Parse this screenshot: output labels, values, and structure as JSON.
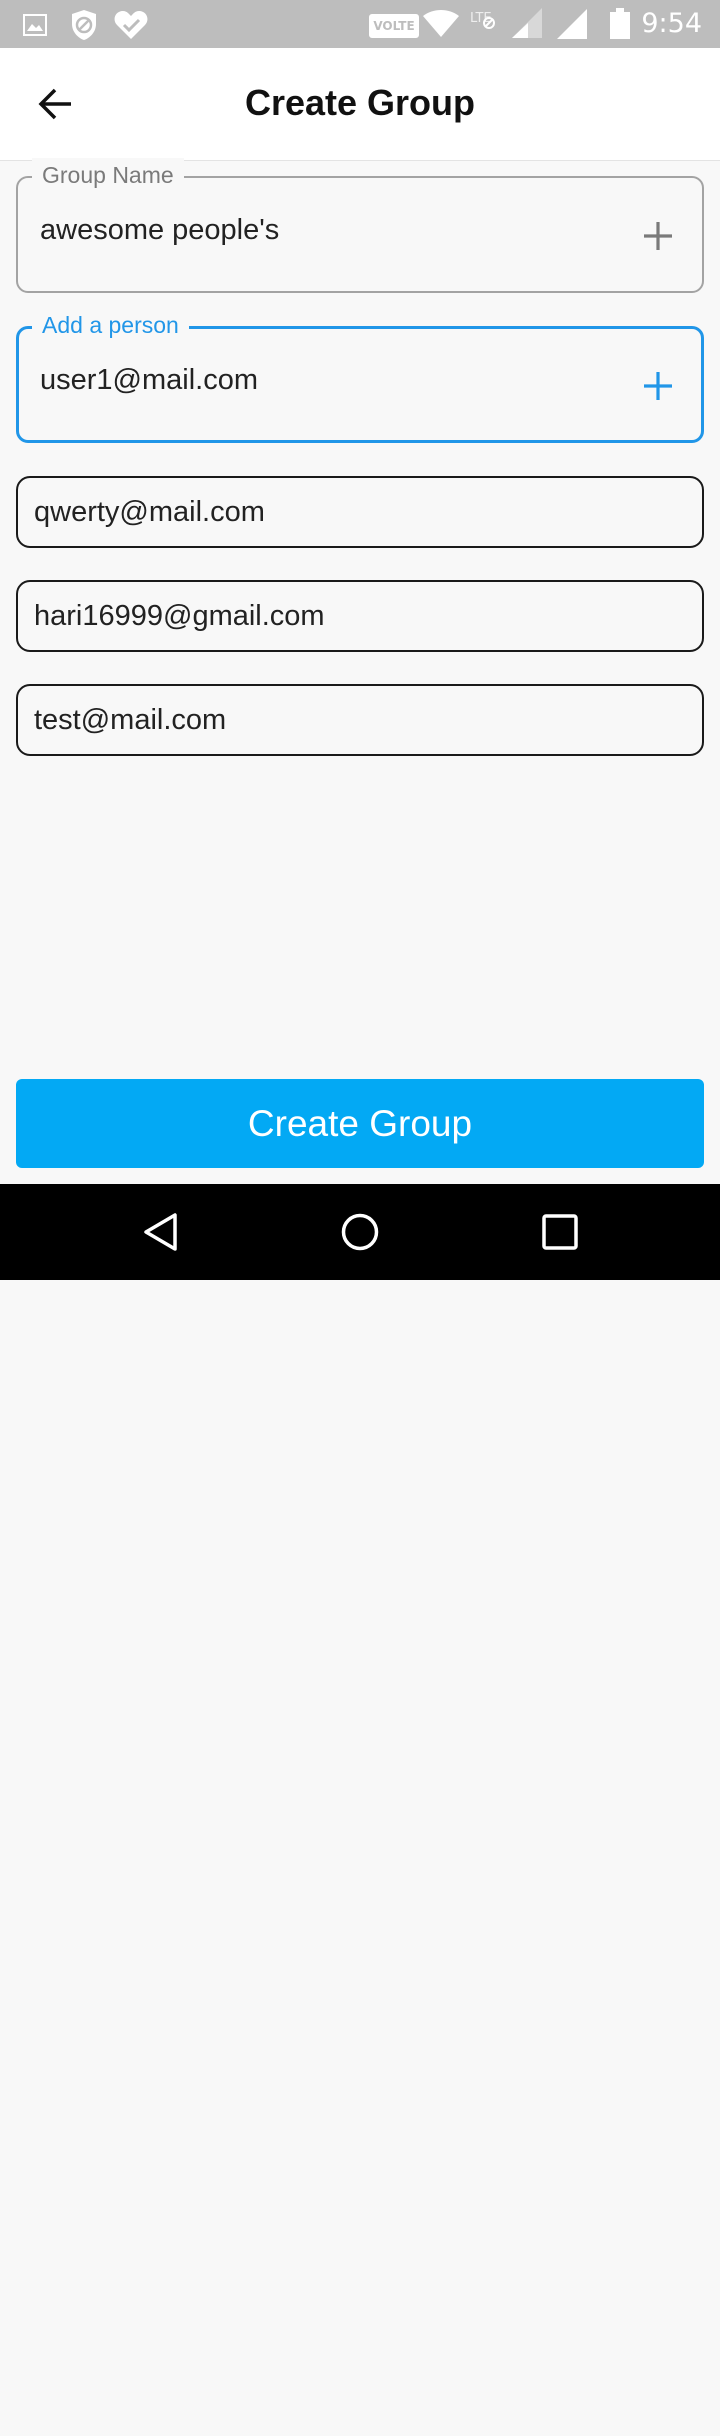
{
  "status_bar": {
    "time": "9:54",
    "volte": "VOLTE",
    "icons": [
      "image-icon",
      "shield-blocked-icon",
      "heart-check-icon",
      "wifi-icon",
      "lte-signal-icon",
      "signal-icon",
      "battery-icon"
    ]
  },
  "app_bar": {
    "title": "Create Group",
    "back_icon": "arrow-left-icon"
  },
  "group_name_field": {
    "label": "Group Name",
    "value": "awesome people's",
    "add_icon": "plus-icon"
  },
  "add_person_field": {
    "label": "Add a person",
    "value": "user1@mail.com",
    "add_icon": "plus-icon"
  },
  "members": [
    {
      "email": "qwerty@mail.com"
    },
    {
      "email": "hari16999@gmail.com"
    },
    {
      "email": "test@mail.com"
    }
  ],
  "create_button": {
    "label": "Create Group"
  },
  "nav_bar": {
    "icons": [
      "back-triangle-icon",
      "home-circle-icon",
      "recents-square-icon"
    ]
  },
  "colors": {
    "accent_blue": "#2196e8",
    "button_blue": "#03a9f4",
    "status_bar_gray": "#bdbdbd"
  }
}
